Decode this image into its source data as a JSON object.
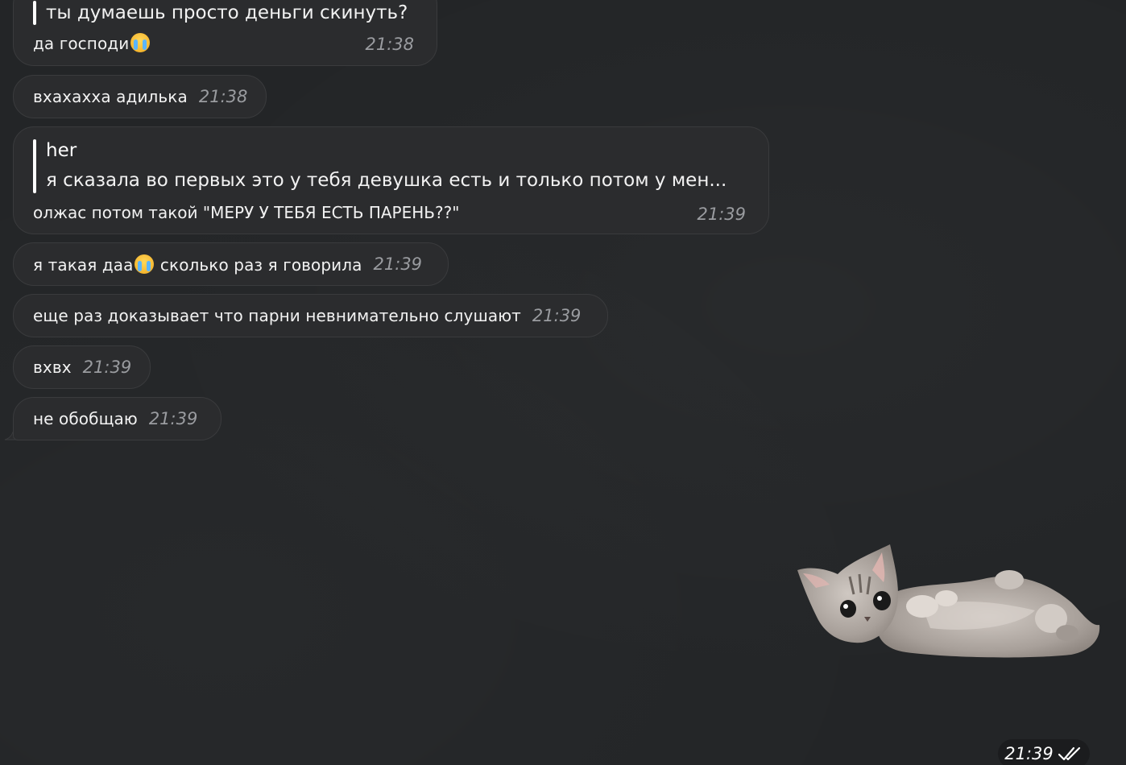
{
  "messages": [
    {
      "quote_text": "ты думаешь просто деньги скинуть?",
      "text": "да господи",
      "emoji": "crying-face",
      "time": "21:38"
    },
    {
      "text": "вхахахха адилька",
      "time": "21:38"
    },
    {
      "quote_author": "her",
      "quote_text": "я сказала во первых это  у тебя девушка есть и только потом у мен...",
      "text": "олжас потом такой \"МЕРУ У ТЕБЯ ЕСТЬ ПАРЕНЬ??\"",
      "time": "21:39"
    },
    {
      "text_before": "я такая даа",
      "emoji": "crying-face",
      "text_after": " сколько раз я говорила",
      "time": "21:39"
    },
    {
      "text": "еще раз доказывает что парни невнимательно слушают",
      "time": "21:39"
    },
    {
      "text": "вхвх",
      "time": "21:39"
    },
    {
      "text": "не обобщаю",
      "time": "21:39"
    }
  ],
  "sticker": {
    "subject": "kitten-lying-on-back",
    "time": "21:39",
    "status_icon": "double-check-icon"
  },
  "colors": {
    "background": "#232527",
    "bubble": "#2b2c2e",
    "time_text": "#9a9ca0",
    "emoji_tear": "#5ab5ff"
  }
}
